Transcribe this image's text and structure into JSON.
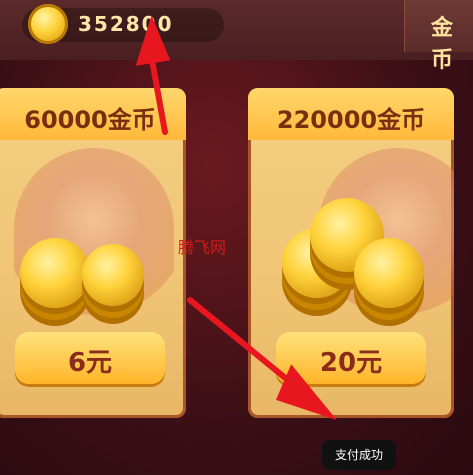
{
  "topbar": {
    "coin_amount": "352800",
    "tab_label": "金币"
  },
  "cards": [
    {
      "title": "60000金币",
      "price": "6元"
    },
    {
      "title": "220000金币",
      "price": "20元"
    }
  ],
  "watermark": "腾飞网",
  "toast": "支付成功",
  "colors": {
    "arrow": "#e8161f",
    "accent": "#ffb93a"
  }
}
